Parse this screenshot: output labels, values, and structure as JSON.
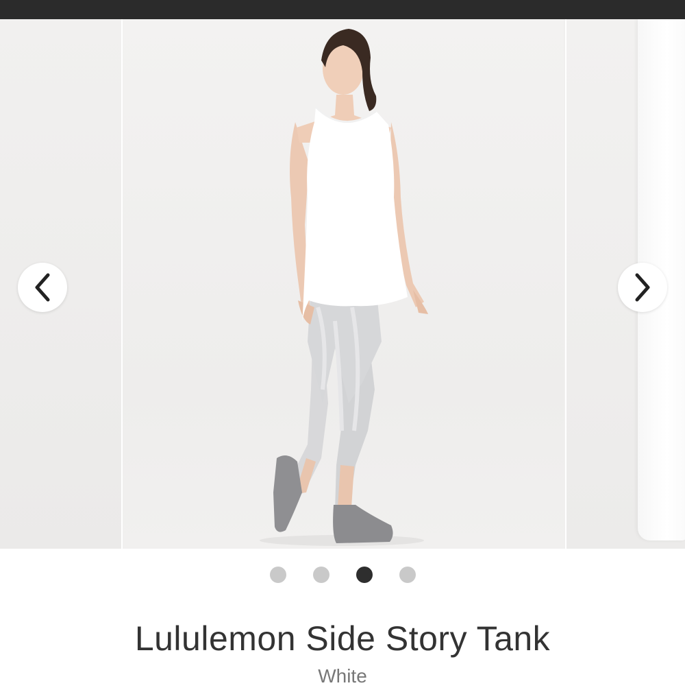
{
  "product": {
    "title": "Lululemon Side Story Tank",
    "color": "White"
  },
  "carousel": {
    "slide_count": 4,
    "active_index": 2,
    "prev_icon": "chevron-left-icon",
    "next_icon": "chevron-right-icon"
  },
  "colors": {
    "top_bar": "#2b2b2b",
    "dot_inactive": "#c9c9c9",
    "dot_active": "#2e2e2e"
  }
}
